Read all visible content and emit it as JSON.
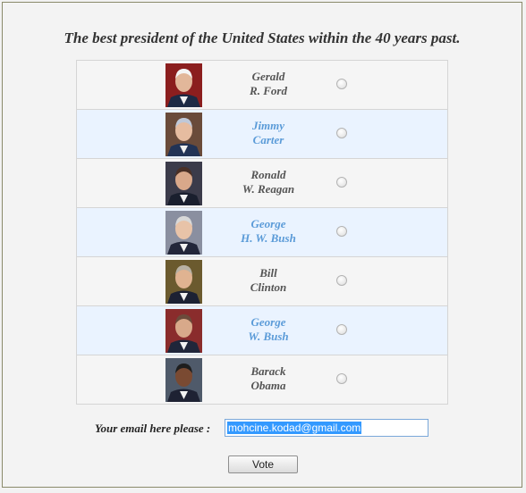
{
  "poll": {
    "title": "The best president of the United States within the 40 years past.",
    "candidates": [
      {
        "first": "Gerald",
        "last": "R. Ford",
        "selected": false
      },
      {
        "first": "Jimmy",
        "last": "Carter",
        "selected": false
      },
      {
        "first": "Ronald",
        "last": "W. Reagan",
        "selected": false
      },
      {
        "first": "George",
        "last": "H. W. Bush",
        "selected": false
      },
      {
        "first": "Bill",
        "last": "Clinton",
        "selected": false
      },
      {
        "first": "George",
        "last": "W. Bush",
        "selected": false
      },
      {
        "first": "Barack",
        "last": "Obama",
        "selected": false
      }
    ]
  },
  "email": {
    "label": "Your email here please :",
    "value": "mohcine.kodad@gmail.com"
  },
  "vote": {
    "label": "Vote"
  },
  "colors": {
    "row_odd": "#f5f5f5",
    "row_even": "#eaf3ff",
    "name_odd": "#555555",
    "name_even": "#5b9bd8",
    "selection": "#3399ff"
  }
}
